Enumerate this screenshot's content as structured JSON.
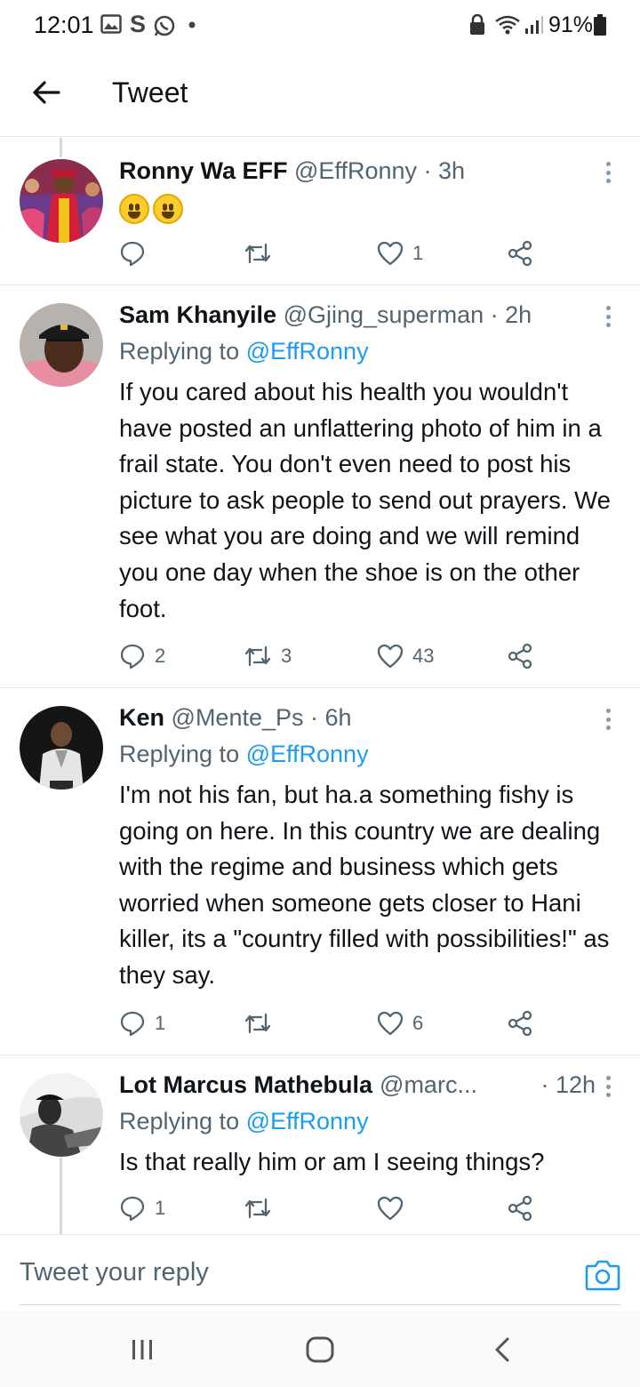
{
  "status_bar": {
    "time": "12:01",
    "battery": "91%",
    "icons": [
      "gallery-icon",
      "s-icon",
      "whatsapp-icon",
      "dot-icon",
      "lock-icon",
      "wifi-icon",
      "signal-icon",
      "battery-icon"
    ]
  },
  "header": {
    "title": "Tweet"
  },
  "tweets": [
    {
      "name": "Ronny Wa EFF",
      "handle": "@EffRonny",
      "time": "· 3h",
      "emojis": [
        "grinning-face",
        "grinning-face"
      ],
      "replies": "",
      "retweets": "",
      "likes": "1"
    },
    {
      "name": "Sam Khanyile",
      "handle": "@Gjing_superman",
      "time": "· 2h",
      "replying_prefix": "Replying to ",
      "replying_to": "@EffRonny",
      "text": "If you cared about his health you wouldn't have posted an unflattering photo of him in a frail state. You don't even need to post his picture to ask people to send out prayers. We see what you are doing and we will remind you one day when the shoe is on the other foot.",
      "replies": "2",
      "retweets": "3",
      "likes": "43"
    },
    {
      "name": "Ken",
      "handle": "@Mente_Ps",
      "time": "· 6h",
      "replying_prefix": "Replying to ",
      "replying_to": "@EffRonny",
      "text": "I'm not his fan, but ha.a something fishy is going on here. In this country we are dealing with the regime and business which gets worried when someone gets closer to Hani killer, its a \"country filled with possibilities!\" as they say.",
      "replies": "1",
      "retweets": "",
      "likes": "6"
    },
    {
      "name": "Lot Marcus Mathebula",
      "handle": "@marc...",
      "time": "· 12h",
      "replying_prefix": "Replying to ",
      "replying_to": "@EffRonny",
      "text": "Is that really him or am I seeing things?",
      "replies": "1",
      "retweets": "",
      "likes": ""
    }
  ],
  "reply_bar": {
    "placeholder": "Tweet your reply"
  },
  "colors": {
    "accent": "#1d9bf0",
    "secondary_text": "#536471",
    "divider": "#e7e7e7"
  },
  "nav": {
    "buttons": [
      "recents-icon",
      "home-icon",
      "back-icon"
    ]
  }
}
